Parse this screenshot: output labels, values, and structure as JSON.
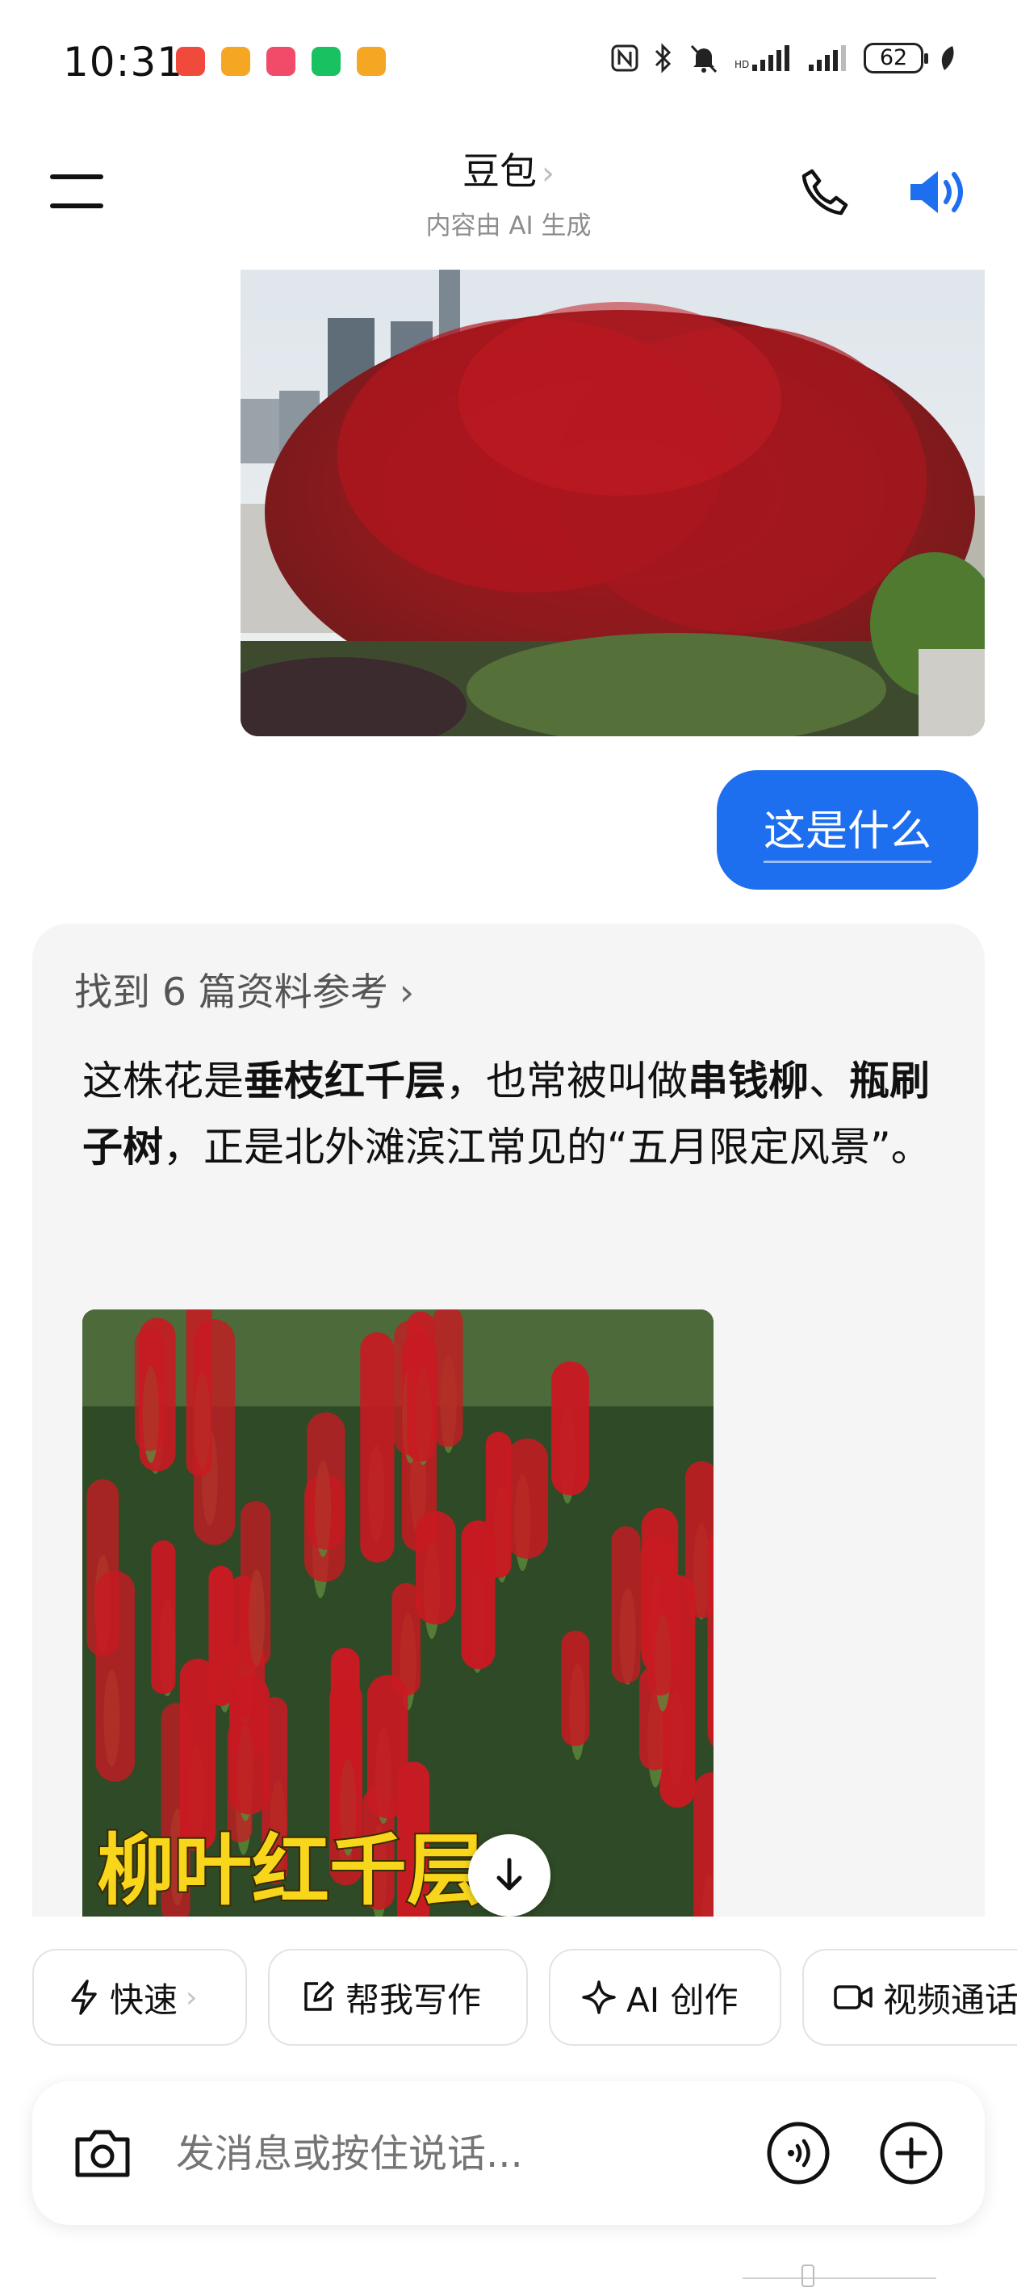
{
  "status_bar": {
    "time": "10:31",
    "battery": "62",
    "app_icons": [
      "missed-call-icon",
      "notes-icon",
      "app-icon",
      "wechat-icon",
      "notes-icon"
    ],
    "system_icons": [
      "nfc-icon",
      "bluetooth-icon",
      "mute-icon",
      "signal-icon",
      "signal-icon",
      "battery-icon",
      "leaf-icon"
    ]
  },
  "header": {
    "title": "豆包",
    "subtitle": "内容由 AI 生成",
    "icons": [
      "menu-icon",
      "phone-icon",
      "speaker-icon"
    ]
  },
  "chat": {
    "user_message": "这是什么",
    "references": "找到 6 篇资料参考",
    "answer": [
      {
        "text": "这株花是",
        "bold": false
      },
      {
        "text": "垂枝红千层",
        "bold": true
      },
      {
        "text": "，也常被叫做",
        "bold": false
      },
      {
        "text": "串钱柳",
        "bold": true
      },
      {
        "text": "、",
        "bold": false
      },
      {
        "text": "瓶刷子树",
        "bold": true
      },
      {
        "text": "，正是北外滩滨江常见的“五月限定风景”。",
        "bold": false
      }
    ],
    "image_caption": "柳叶红千层"
  },
  "chips": [
    {
      "label": "快速",
      "icon": "lightning-icon",
      "chevron": "›"
    },
    {
      "label": "帮我写作",
      "icon": "edit-icon"
    },
    {
      "label": "AI 创作",
      "icon": "sparkle-icon"
    },
    {
      "label": "视频通话",
      "icon": "video-icon"
    }
  ],
  "input": {
    "placeholder": "发消息或按住说话..."
  },
  "colors": {
    "accent": "#1e6ff0",
    "card_bg": "#f5f5f5",
    "flower_red": "#c81a22"
  }
}
